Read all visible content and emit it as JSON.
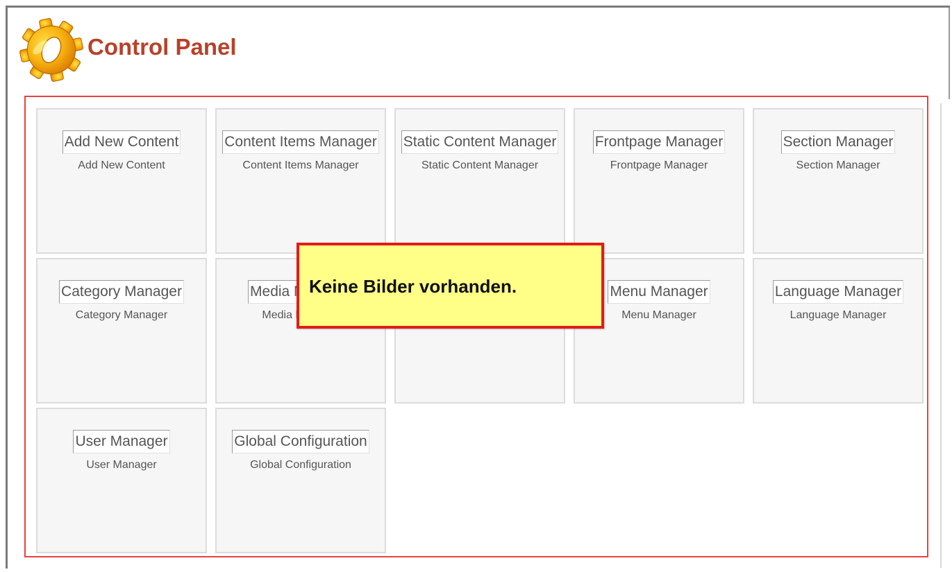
{
  "header": {
    "title": "Control Panel",
    "icon": "gear-icon",
    "title_color": "#b8412a"
  },
  "tiles": [
    {
      "image_text": "Add New Content",
      "label": "Add New Content"
    },
    {
      "image_text": "Content Items Manager",
      "label": "Content Items Manager"
    },
    {
      "image_text": "Static Content Manager",
      "label": "Static Content Manager"
    },
    {
      "image_text": "Frontpage Manager",
      "label": "Frontpage Manager"
    },
    {
      "image_text": "Section Manager",
      "label": "Section Manager"
    },
    {
      "image_text": "Category Manager",
      "label": "Category Manager"
    },
    {
      "image_text": "Media Manager",
      "label": "Media Manager"
    },
    {
      "image_text": "",
      "label": ""
    },
    {
      "image_text": "Menu Manager",
      "label": "Menu Manager"
    },
    {
      "image_text": "Language Manager",
      "label": "Language Manager"
    },
    {
      "image_text": "User Manager",
      "label": "User Manager"
    },
    {
      "image_text": "Global Configuration",
      "label": "Global Configuration"
    }
  ],
  "alert": {
    "message": "Keine Bilder vorhanden.",
    "border_color": "#e41b17",
    "background_color": "#ffff88"
  },
  "colors": {
    "panel_border": "#e8413e",
    "tile_background": "#f6f6f6"
  }
}
